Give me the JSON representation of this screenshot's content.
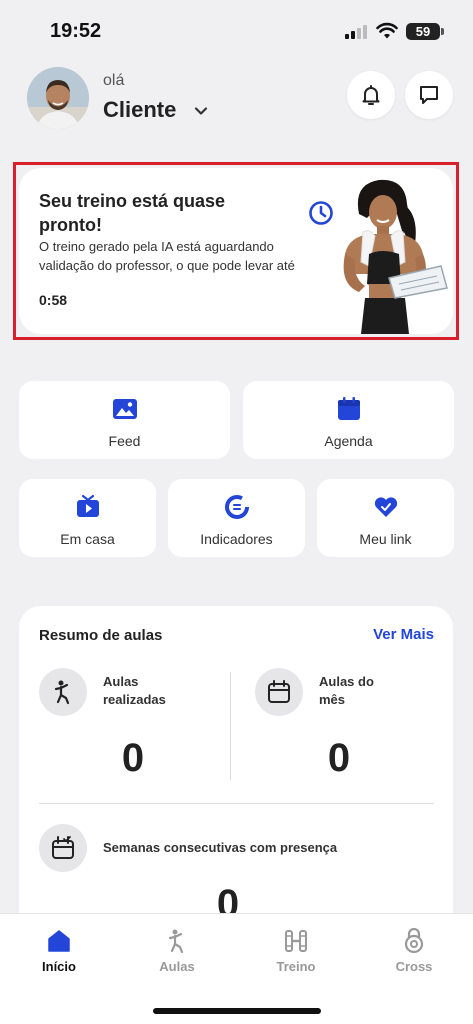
{
  "status_bar": {
    "time": "19:52",
    "battery": "59"
  },
  "header": {
    "greeting": "olá",
    "user_name": "Cliente"
  },
  "training_card": {
    "title": "Seu treino está quase pronto!",
    "description": "O treino gerado pela IA está aguardando validação do professor, o que pode levar até",
    "time": "0:58"
  },
  "shortcuts": {
    "feed": "Feed",
    "agenda": "Agenda",
    "em_casa": "Em casa",
    "indicadores": "Indicadores",
    "meu_link": "Meu link"
  },
  "summary": {
    "title": "Resumo de aulas",
    "see_more": "Ver Mais",
    "aulas_realizadas_label_1": "Aulas",
    "aulas_realizadas_label_2": "realizadas",
    "aulas_realizadas_value": "0",
    "aulas_mes_label_1": "Aulas do",
    "aulas_mes_label_2": "mês",
    "aulas_mes_value": "0",
    "semanas_label": "Semanas consecutivas com presença",
    "semanas_value": "0"
  },
  "tab_bar": {
    "inicio": "Início",
    "aulas": "Aulas",
    "treino": "Treino",
    "cross": "Cross"
  },
  "colors": {
    "accent": "#2346d8",
    "highlight": "#d9202a",
    "background": "#f0f0f2"
  }
}
